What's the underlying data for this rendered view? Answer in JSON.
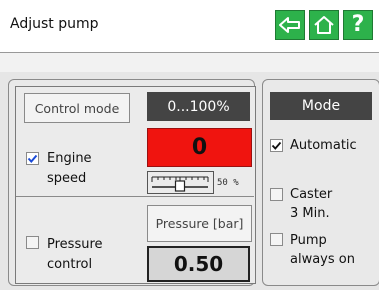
{
  "header": {
    "title": "Adjust pump"
  },
  "nav": {
    "back_icon": "arrow-left-icon",
    "home_icon": "home-icon",
    "help_label": "?"
  },
  "colors": {
    "accent": "#2db24b",
    "alarm": "#f0140f",
    "dark": "#444444"
  },
  "control": {
    "mode_button": "Control mode",
    "range": "0...100%",
    "engine_speed": {
      "label_line1": "Engine",
      "label_line2": "speed",
      "checked": true,
      "value": "0",
      "slider_label": "50 %",
      "slider_value_pct": 50
    },
    "pressure": {
      "button": "Pressure [bar]",
      "label_line1": "Pressure",
      "label_line2": "control",
      "checked": false,
      "value": "0.50"
    }
  },
  "mode": {
    "header": "Mode",
    "automatic": {
      "label": "Automatic",
      "checked": true
    },
    "caster": {
      "label_line1": "Caster",
      "label_line2": "3 Min.",
      "checked": false
    },
    "pump_on": {
      "label_line1": "Pump",
      "label_line2": "always on",
      "checked": false
    }
  }
}
